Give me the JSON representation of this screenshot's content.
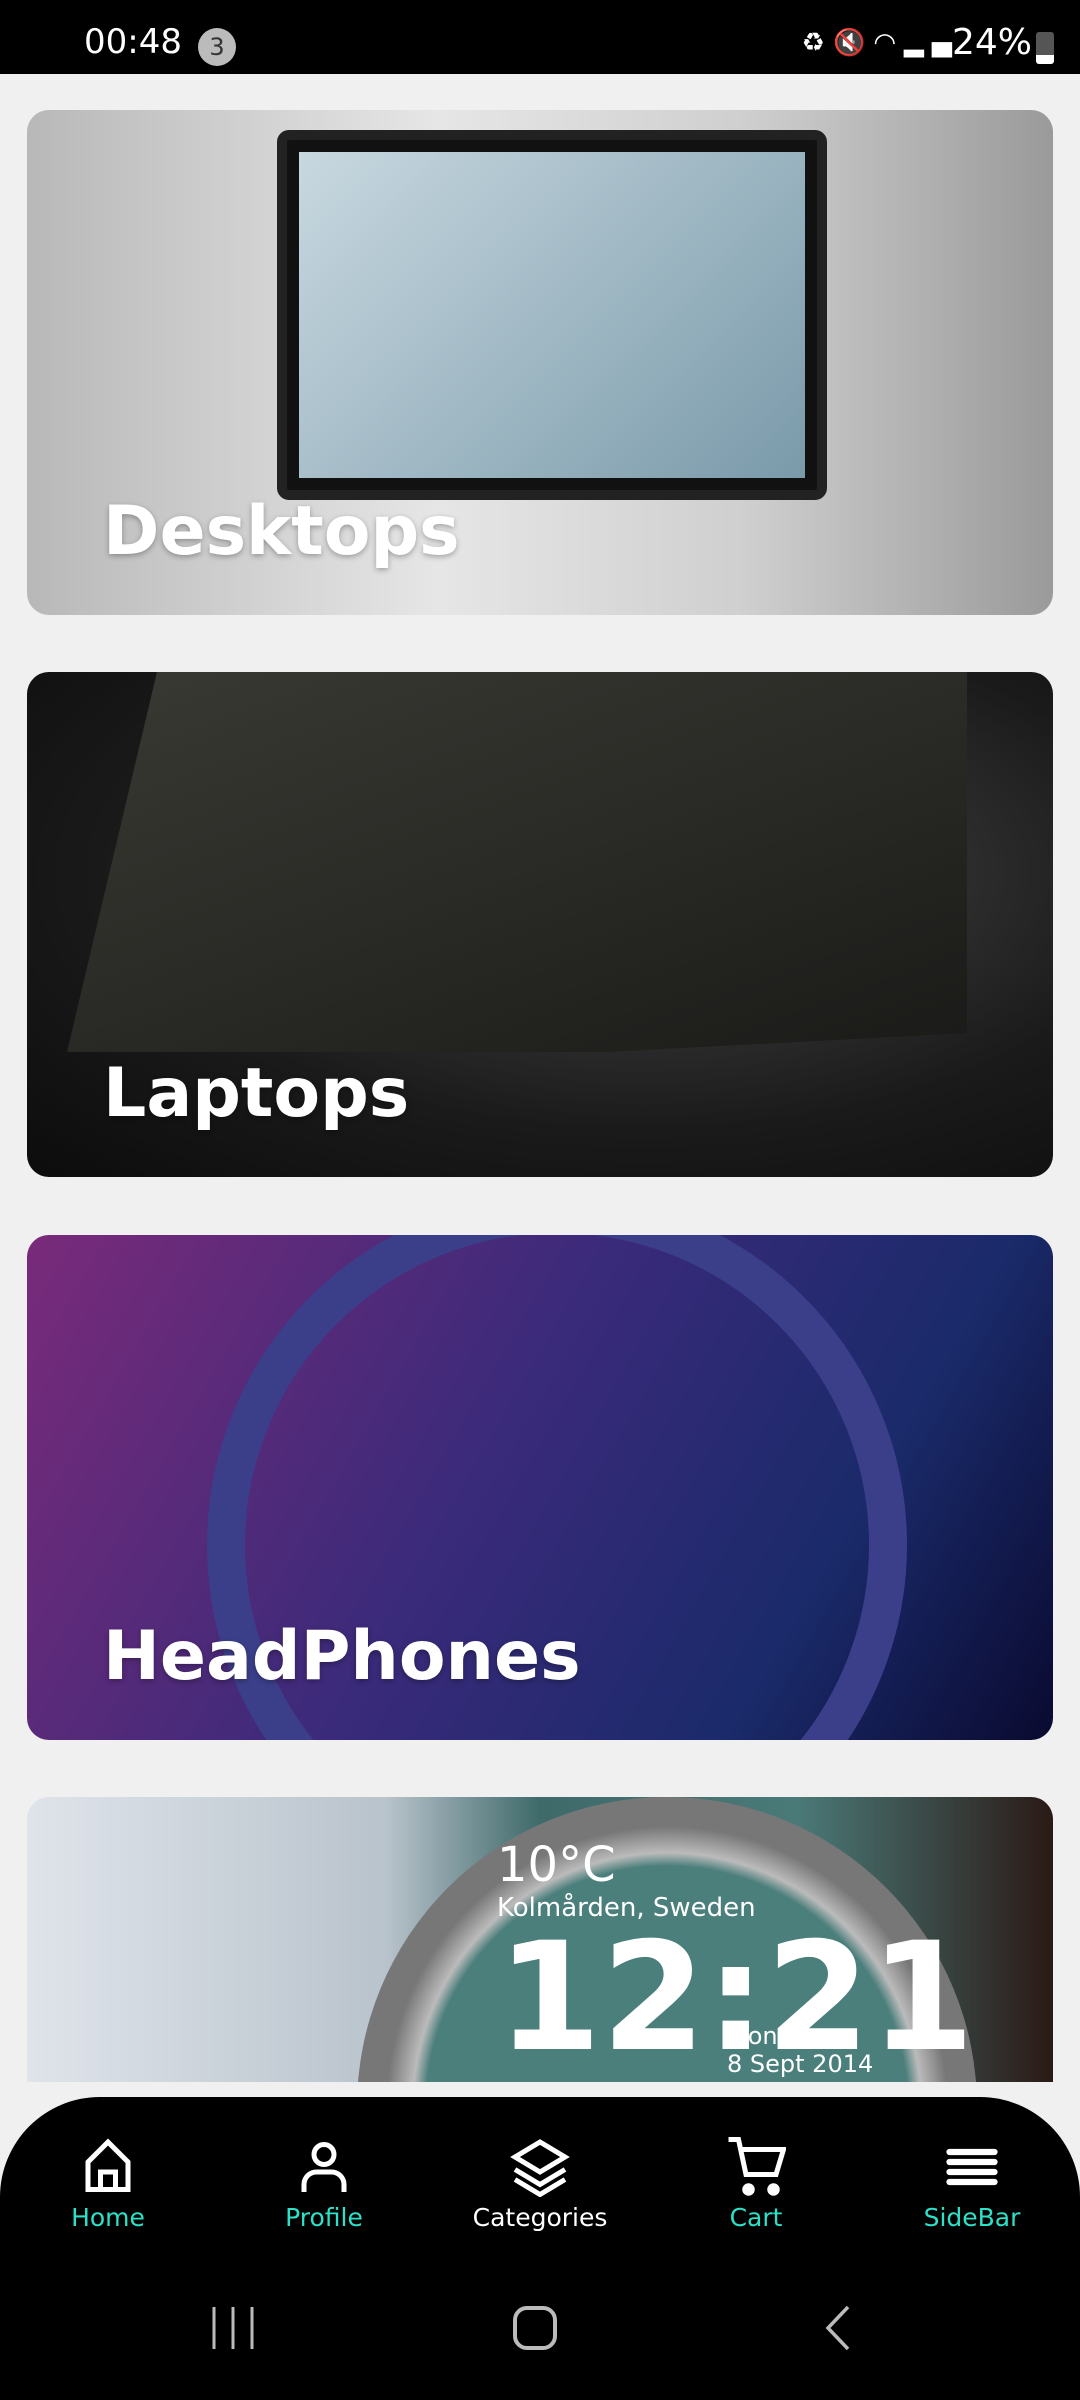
{
  "status_bar": {
    "time": "00:48",
    "notification_count": "3",
    "icons": [
      "battery-saver-icon",
      "mute-icon",
      "wifi-icon",
      "signal-icon",
      "roaming-signal-icon"
    ],
    "battery": "24%"
  },
  "categories": [
    {
      "label": "Desktops"
    },
    {
      "label": "Laptops"
    },
    {
      "label": "HeadPhones"
    },
    {
      "label": "",
      "watch_temp": "10°C",
      "watch_location": "Kolmården, Sweden",
      "watch_time": "12:21",
      "watch_day": "Monday",
      "watch_date": "8 Sept 2014"
    }
  ],
  "bottom_nav": {
    "items": [
      {
        "label": "Home",
        "icon": "home-icon"
      },
      {
        "label": "Profile",
        "icon": "person-icon"
      },
      {
        "label": "Categories",
        "icon": "layers-icon",
        "active": true
      },
      {
        "label": "Cart",
        "icon": "cart-icon"
      },
      {
        "label": "SideBar",
        "icon": "menu-icon"
      }
    ],
    "accent": "#2de0c8",
    "active_color": "#ffffff"
  }
}
